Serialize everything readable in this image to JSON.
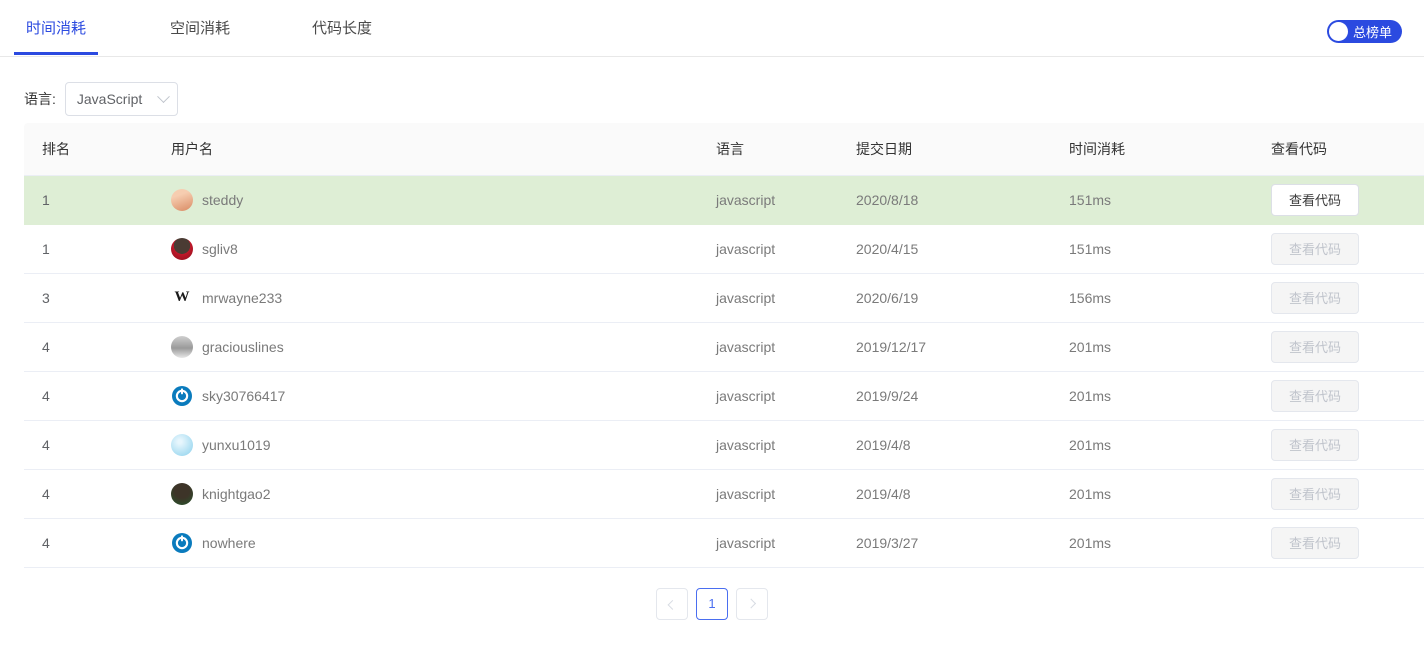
{
  "tabs": [
    {
      "label": "时间消耗",
      "active": true
    },
    {
      "label": "空间消耗",
      "active": false
    },
    {
      "label": "代码长度",
      "active": false
    }
  ],
  "toggle": {
    "label": "总榜单",
    "on": false,
    "color": "#2b4ae0"
  },
  "filter": {
    "label": "语言:",
    "value": "JavaScript",
    "icon": "chevron-down-icon"
  },
  "table": {
    "columns": [
      "排名",
      "用户名",
      "语言",
      "提交日期",
      "时间消耗",
      "查看代码"
    ],
    "rows": [
      {
        "rank": "1",
        "user": "steddy",
        "avatar": "av-steddy",
        "lang": "javascript",
        "date": "2020/8/18",
        "time": "151ms",
        "action": "查看代码",
        "disabled": false,
        "highlight": true
      },
      {
        "rank": "1",
        "user": "sgliv8",
        "avatar": "av-sgliv8",
        "lang": "javascript",
        "date": "2020/4/15",
        "time": "151ms",
        "action": "查看代码",
        "disabled": true,
        "highlight": false
      },
      {
        "rank": "3",
        "user": "mrwayne233",
        "avatar": "av-letter",
        "avatar_text": "W",
        "lang": "javascript",
        "date": "2020/6/19",
        "time": "156ms",
        "action": "查看代码",
        "disabled": true,
        "highlight": false
      },
      {
        "rank": "4",
        "user": "graciouslines",
        "avatar": "av-gray",
        "lang": "javascript",
        "date": "2019/12/17",
        "time": "201ms",
        "action": "查看代码",
        "disabled": true,
        "highlight": false
      },
      {
        "rank": "4",
        "user": "sky30766417",
        "avatar": "av-lc",
        "lang": "javascript",
        "date": "2019/9/24",
        "time": "201ms",
        "action": "查看代码",
        "disabled": true,
        "highlight": false
      },
      {
        "rank": "4",
        "user": "yunxu1019",
        "avatar": "av-cloud",
        "lang": "javascript",
        "date": "2019/4/8",
        "time": "201ms",
        "action": "查看代码",
        "disabled": true,
        "highlight": false
      },
      {
        "rank": "4",
        "user": "knightgao2",
        "avatar": "av-photo",
        "lang": "javascript",
        "date": "2019/4/8",
        "time": "201ms",
        "action": "查看代码",
        "disabled": true,
        "highlight": false
      },
      {
        "rank": "4",
        "user": "nowhere",
        "avatar": "av-lc",
        "lang": "javascript",
        "date": "2019/3/27",
        "time": "201ms",
        "action": "查看代码",
        "disabled": true,
        "highlight": false
      }
    ]
  },
  "pagination": {
    "prev_icon": "chevron-left-icon",
    "next_icon": "chevron-right-icon",
    "pages": [
      "1"
    ],
    "current": "1"
  }
}
